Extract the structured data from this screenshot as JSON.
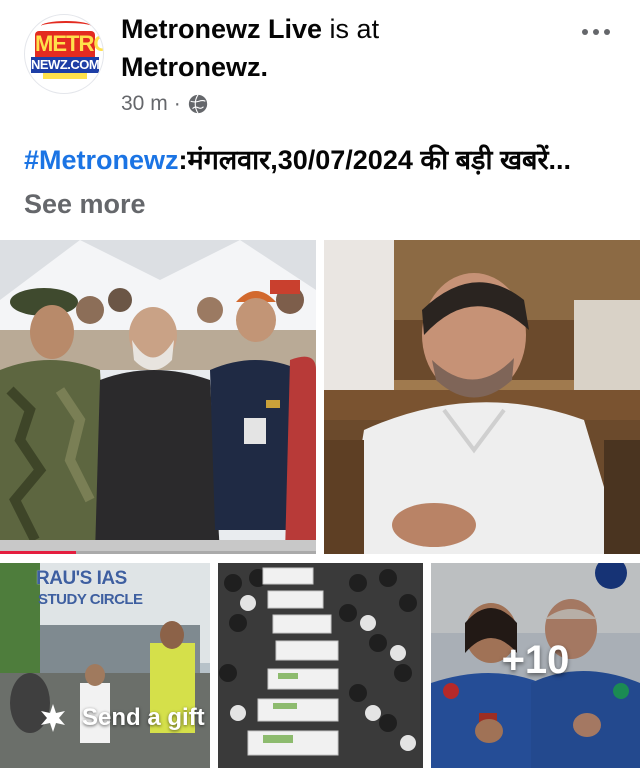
{
  "post": {
    "page_name": "Metronewz Live",
    "is_at": " is at",
    "location": "Metronewz.",
    "time": "30 m",
    "separator": "·",
    "privacy_icon": "globe-icon",
    "more_icon": "more-options-icon"
  },
  "avatar": {
    "logo_top": "METRO",
    "logo_bottom": "NEWZ.COM"
  },
  "caption": {
    "hashtag": "#Metronewz",
    "text": ":मंगलवार,30/07/2024  की बड़ी खबरें...",
    "see_more": " See more"
  },
  "photos": {
    "p1": {
      "signs": []
    },
    "p2": {
      "signs": []
    },
    "p3": {
      "sign_line1": "RAU'S IAS",
      "sign_line2": "STUDY CIRCLE"
    },
    "p4": {
      "signs": []
    },
    "p5": {
      "signs": []
    },
    "progress_fraction": 0.24
  },
  "gift": {
    "icon": "gift-icon",
    "label": "Send a gift"
  },
  "more_photos": {
    "label": "+10"
  },
  "colors": {
    "link_blue": "#1b74e4",
    "meta_gray": "#65676b",
    "progress_red": "#e41e3f"
  }
}
